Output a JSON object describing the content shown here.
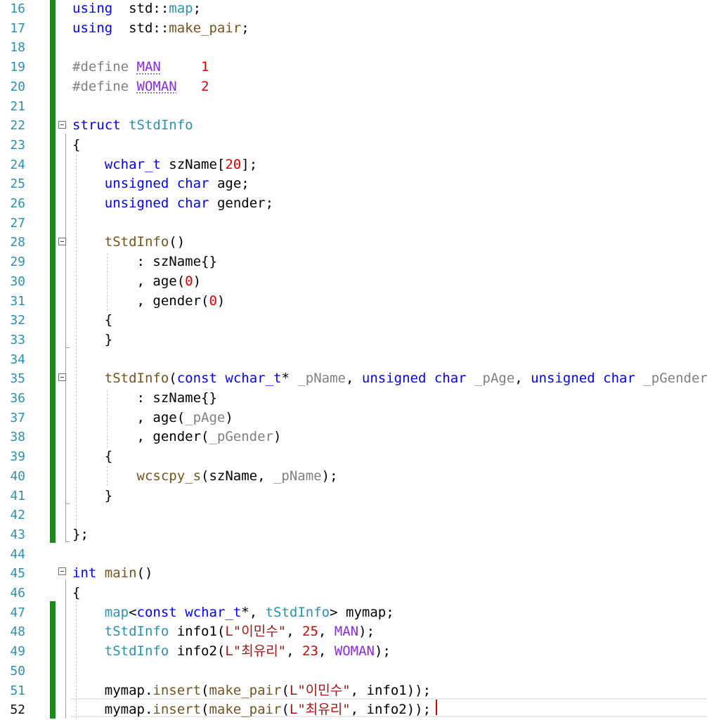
{
  "editor": {
    "current_line": 52,
    "lines": [
      {
        "n": 16,
        "tokens": [
          [
            "k",
            "using"
          ],
          [
            "",
            "  std::"
          ],
          [
            "t",
            "map"
          ],
          [
            "",
            ";"
          ]
        ]
      },
      {
        "n": 17,
        "tokens": [
          [
            "k",
            "using"
          ],
          [
            "",
            "  std::"
          ],
          [
            "f",
            "make_pair"
          ],
          [
            "",
            ";"
          ]
        ]
      },
      {
        "n": 18,
        "tokens": []
      },
      {
        "n": 19,
        "tokens": [
          [
            "pp",
            "#define "
          ],
          [
            "m",
            "MAN"
          ],
          [
            "",
            "     "
          ],
          [
            "n",
            "1"
          ]
        ]
      },
      {
        "n": 20,
        "tokens": [
          [
            "pp",
            "#define "
          ],
          [
            "m",
            "WOMAN"
          ],
          [
            "",
            "   "
          ],
          [
            "n",
            "2"
          ]
        ]
      },
      {
        "n": 21,
        "tokens": []
      },
      {
        "n": 22,
        "tokens": [
          [
            "k",
            "struct"
          ],
          [
            "",
            " "
          ],
          [
            "t",
            "tStdInfo"
          ]
        ]
      },
      {
        "n": 23,
        "tokens": [
          [
            "",
            "{"
          ]
        ]
      },
      {
        "n": 24,
        "tokens": [
          [
            "",
            "    "
          ],
          [
            "k",
            "wchar_t"
          ],
          [
            "",
            " szName["
          ],
          [
            "n",
            "20"
          ],
          [
            "",
            "];"
          ]
        ]
      },
      {
        "n": 25,
        "tokens": [
          [
            "",
            "    "
          ],
          [
            "k",
            "unsigned"
          ],
          [
            "",
            " "
          ],
          [
            "k",
            "char"
          ],
          [
            "",
            " age;"
          ]
        ]
      },
      {
        "n": 26,
        "tokens": [
          [
            "",
            "    "
          ],
          [
            "k",
            "unsigned"
          ],
          [
            "",
            " "
          ],
          [
            "k",
            "char"
          ],
          [
            "",
            " gender;"
          ]
        ]
      },
      {
        "n": 27,
        "tokens": []
      },
      {
        "n": 28,
        "tokens": [
          [
            "",
            "    "
          ],
          [
            "f",
            "tStdInfo"
          ],
          [
            "",
            "()"
          ]
        ]
      },
      {
        "n": 29,
        "tokens": [
          [
            "",
            "        : szName{}"
          ]
        ]
      },
      {
        "n": 30,
        "tokens": [
          [
            "",
            "        , age("
          ],
          [
            "n",
            "0"
          ],
          [
            "",
            ")"
          ]
        ]
      },
      {
        "n": 31,
        "tokens": [
          [
            "",
            "        , gender("
          ],
          [
            "n",
            "0"
          ],
          [
            "",
            ")"
          ]
        ]
      },
      {
        "n": 32,
        "tokens": [
          [
            "",
            "    {"
          ]
        ]
      },
      {
        "n": 33,
        "tokens": [
          [
            "",
            "    }"
          ]
        ]
      },
      {
        "n": 34,
        "tokens": []
      },
      {
        "n": 35,
        "tokens": [
          [
            "",
            "    "
          ],
          [
            "f",
            "tStdInfo"
          ],
          [
            "",
            "("
          ],
          [
            "k",
            "const"
          ],
          [
            "",
            " "
          ],
          [
            "k",
            "wchar_t"
          ],
          [
            "",
            "* "
          ],
          [
            "p",
            "_pName"
          ],
          [
            "",
            ", "
          ],
          [
            "k",
            "unsigned"
          ],
          [
            "",
            " "
          ],
          [
            "k",
            "char"
          ],
          [
            "",
            " "
          ],
          [
            "p",
            "_pAge"
          ],
          [
            "",
            ", "
          ],
          [
            "k",
            "unsigned"
          ],
          [
            "",
            " "
          ],
          [
            "k",
            "char"
          ],
          [
            "",
            " "
          ],
          [
            "p",
            "_pGender"
          ],
          [
            "",
            ")"
          ]
        ]
      },
      {
        "n": 36,
        "tokens": [
          [
            "",
            "        : szName{}"
          ]
        ]
      },
      {
        "n": 37,
        "tokens": [
          [
            "",
            "        , age("
          ],
          [
            "p",
            "_pAge"
          ],
          [
            "",
            ")"
          ]
        ]
      },
      {
        "n": 38,
        "tokens": [
          [
            "",
            "        , gender("
          ],
          [
            "p",
            "_pGender"
          ],
          [
            "",
            ")"
          ]
        ]
      },
      {
        "n": 39,
        "tokens": [
          [
            "",
            "    {"
          ]
        ]
      },
      {
        "n": 40,
        "tokens": [
          [
            "",
            "        "
          ],
          [
            "f",
            "wcscpy_s"
          ],
          [
            "",
            "(szName, "
          ],
          [
            "p",
            "_pName"
          ],
          [
            "",
            ");"
          ]
        ]
      },
      {
        "n": 41,
        "tokens": [
          [
            "",
            "    }"
          ]
        ]
      },
      {
        "n": 42,
        "tokens": []
      },
      {
        "n": 43,
        "tokens": [
          [
            "",
            "};"
          ]
        ]
      },
      {
        "n": 44,
        "tokens": []
      },
      {
        "n": 45,
        "tokens": [
          [
            "k",
            "int"
          ],
          [
            "",
            " "
          ],
          [
            "f",
            "main"
          ],
          [
            "",
            "()"
          ]
        ]
      },
      {
        "n": 46,
        "tokens": [
          [
            "",
            "{"
          ]
        ]
      },
      {
        "n": 47,
        "tokens": [
          [
            "",
            "    "
          ],
          [
            "t",
            "map"
          ],
          [
            "",
            "<"
          ],
          [
            "k",
            "const"
          ],
          [
            "",
            " "
          ],
          [
            "k",
            "wchar_t"
          ],
          [
            "",
            "*, "
          ],
          [
            "t",
            "tStdInfo"
          ],
          [
            "",
            "> mymap;"
          ]
        ]
      },
      {
        "n": 48,
        "tokens": [
          [
            "",
            "    "
          ],
          [
            "t",
            "tStdInfo"
          ],
          [
            "",
            " info1("
          ],
          [
            "s",
            "L\"이민수\""
          ],
          [
            "",
            ", "
          ],
          [
            "n",
            "25"
          ],
          [
            "",
            ", "
          ],
          [
            "m",
            "MAN"
          ],
          [
            "",
            ");"
          ]
        ]
      },
      {
        "n": 49,
        "tokens": [
          [
            "",
            "    "
          ],
          [
            "t",
            "tStdInfo"
          ],
          [
            "",
            " info2("
          ],
          [
            "s",
            "L\"최유리\""
          ],
          [
            "",
            ", "
          ],
          [
            "n",
            "23"
          ],
          [
            "",
            ", "
          ],
          [
            "m",
            "WOMAN"
          ],
          [
            "",
            ");"
          ]
        ]
      },
      {
        "n": 50,
        "tokens": []
      },
      {
        "n": 51,
        "tokens": [
          [
            "",
            "    mymap."
          ],
          [
            "f",
            "insert"
          ],
          [
            "",
            "("
          ],
          [
            "f",
            "make_pair"
          ],
          [
            "",
            "("
          ],
          [
            "s",
            "L\"이민수\""
          ],
          [
            "",
            ", info1));"
          ]
        ]
      },
      {
        "n": 52,
        "tokens": [
          [
            "",
            "    mymap."
          ],
          [
            "f",
            "insert"
          ],
          [
            "",
            "("
          ],
          [
            "f",
            "make_pair"
          ],
          [
            "",
            "("
          ],
          [
            "s",
            "L\"최유리\""
          ],
          [
            "",
            ", info2));"
          ]
        ]
      }
    ]
  }
}
